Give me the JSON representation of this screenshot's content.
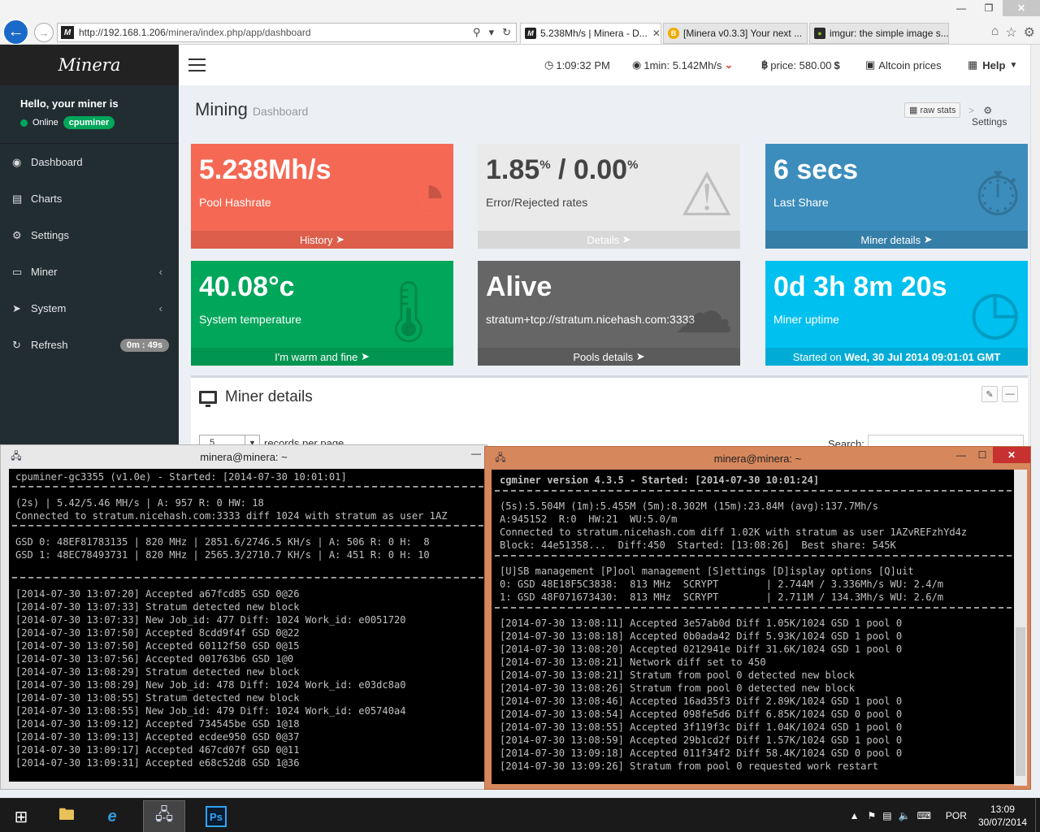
{
  "browser": {
    "url_prefix": "http://192.168.1.206",
    "url_path": "/minera/index.php/app/dashboard",
    "tabs": [
      {
        "label": "5.238Mh/s | Minera - D..."
      },
      {
        "label": "[Minera v0.3.3] Your next ..."
      },
      {
        "label": "imgur: the simple image s..."
      }
    ]
  },
  "sidebar": {
    "brand": "Minera",
    "hello": "Hello, your miner is",
    "status": "Online",
    "miner_badge": "cpuminer",
    "items": [
      {
        "label": "Dashboard"
      },
      {
        "label": "Charts"
      },
      {
        "label": "Settings"
      },
      {
        "label": "Miner"
      },
      {
        "label": "System"
      },
      {
        "label": "Refresh",
        "badge": "0m : 49s"
      }
    ]
  },
  "topbar": {
    "time": "1:09:32 PM",
    "hashrate": "1min: 5.142Mh/s",
    "price": "price: 580.00",
    "price_unit": "$",
    "altcoin": "Altcoin prices",
    "help": "Help"
  },
  "page": {
    "title": "Mining",
    "subtitle": "Dashboard",
    "raw_stats": "raw stats",
    "breadcrumb": "Settings"
  },
  "boxes": [
    {
      "value": "5.238Mh/s",
      "label": "Pool Hashrate",
      "footer": "History",
      "color": "#f56954"
    },
    {
      "value_a": "1.85",
      "value_b": "0.00",
      "unit": "%",
      "sep": " / ",
      "label": "Error/Rejected rates",
      "footer": "Details",
      "color": "#eaeaea"
    },
    {
      "value": "6 secs",
      "label": "Last Share",
      "footer": "Miner details",
      "color": "#3c8dbc"
    },
    {
      "value": "40.08°c",
      "label": "System temperature",
      "footer": "I'm warm and fine",
      "color": "#00a65a"
    },
    {
      "value": "Alive",
      "label": "stratum+tcp://stratum.nicehash.com:3333",
      "footer": "Pools details",
      "color": "#666666"
    },
    {
      "value": "0d 3h 8m 20s",
      "label": "Miner uptime",
      "footer_prefix": "Started on ",
      "footer": "Wed, 30 Jul 2014 09:01:01 GMT",
      "color": "#00c0ef"
    }
  ],
  "miner_panel": {
    "title": "Miner details",
    "per_page_value": "5",
    "per_page_label": "records per page",
    "search_label": "Search:"
  },
  "terminal1": {
    "title": "minera@minera: ~",
    "header": "cpuminer-gc3355 (v1.0e) - Started: [2014-07-30 10:01:01]",
    "stats": [
      "(2s) | 5.42/5.46 MH/s | A: 957 R: 0 HW: 18",
      "Connected to stratum.nicehash.com:3333 diff 1024 with stratum as user 1AZ"
    ],
    "devices": [
      "GSD 0: 48EF81783135 | 820 MHz | 2851.6/2746.5 KH/s | A: 506 R: 0 H:  8",
      "GSD 1: 48EC78493731 | 820 MHz | 2565.3/2710.7 KH/s | A: 451 R: 0 H: 10"
    ],
    "log": [
      "[2014-07-30 13:07:20] Accepted a67fcd85 GSD 0@26",
      "[2014-07-30 13:07:33] Stratum detected new block",
      "[2014-07-30 13:07:33] New Job_id: 477 Diff: 1024 Work_id: e0051720",
      "[2014-07-30 13:07:50] Accepted 8cdd9f4f GSD 0@22",
      "[2014-07-30 13:07:50] Accepted 60112f50 GSD 0@15",
      "[2014-07-30 13:07:56] Accepted 001763b6 GSD 1@0",
      "[2014-07-30 13:08:29] Stratum detected new block",
      "[2014-07-30 13:08:29] New Job_id: 478 Diff: 1024 Work_id: e03dc8a0",
      "[2014-07-30 13:08:55] Stratum detected new block",
      "[2014-07-30 13:08:55] New Job_id: 479 Diff: 1024 Work_id: e05740a4",
      "[2014-07-30 13:09:12] Accepted 734545be GSD 1@18",
      "[2014-07-30 13:09:13] Accepted ecdee950 GSD 0@37",
      "[2014-07-30 13:09:17] Accepted 467cd07f GSD 0@11",
      "[2014-07-30 13:09:31] Accepted e68c52d8 GSD 1@36"
    ]
  },
  "terminal2": {
    "title": "minera@minera: ~",
    "header": "cgminer version 4.3.5 - Started: [2014-07-30 10:01:24]",
    "stats": [
      "(5s):5.504M (1m):5.455M (5m):8.302M (15m):23.84M (avg):137.7Mh/s",
      "A:945152  R:0  HW:21  WU:5.0/m",
      "Connected to stratum.nicehash.com diff 1.02K with stratum as user 1AZvREFzhYd4z",
      "Block: 44e51358...  Diff:450  Started: [13:08:26]  Best share: 545K"
    ],
    "menu": "[U]SB management [P]ool management [S]ettings [D]isplay options [Q]uit",
    "devices": [
      "0: GSD 48E18F5C3838:  813 MHz  SCRYPT        | 2.744M / 3.336Mh/s WU: 2.4/m",
      "1: GSD 48F071673430:  813 MHz  SCRYPT        | 2.711M / 134.3Mh/s WU: 2.6/m"
    ],
    "log": [
      "[2014-07-30 13:08:11] Accepted 3e57ab0d Diff 1.05K/1024 GSD 1 pool 0",
      "[2014-07-30 13:08:18] Accepted 0b0ada42 Diff 5.93K/1024 GSD 1 pool 0",
      "[2014-07-30 13:08:20] Accepted 0212941e Diff 31.6K/1024 GSD 1 pool 0",
      "[2014-07-30 13:08:21] Network diff set to 450",
      "[2014-07-30 13:08:21] Stratum from pool 0 detected new block",
      "[2014-07-30 13:08:26] Stratum from pool 0 detected new block",
      "[2014-07-30 13:08:46] Accepted 16ad35f3 Diff 2.89K/1024 GSD 1 pool 0",
      "[2014-07-30 13:08:54] Accepted 098fe5d6 Diff 6.85K/1024 GSD 0 pool 0",
      "[2014-07-30 13:08:55] Accepted 3f119f3c Diff 1.04K/1024 GSD 1 pool 0",
      "[2014-07-30 13:08:59] Accepted 29b1cd2f Diff 1.57K/1024 GSD 1 pool 0",
      "[2014-07-30 13:09:18] Accepted 011f34f2 Diff 58.4K/1024 GSD 0 pool 0",
      "[2014-07-30 13:09:26] Stratum from pool 0 requested work restart"
    ]
  },
  "taskbar": {
    "lang": "POR",
    "time": "13:09",
    "date": "30/07/2014"
  }
}
